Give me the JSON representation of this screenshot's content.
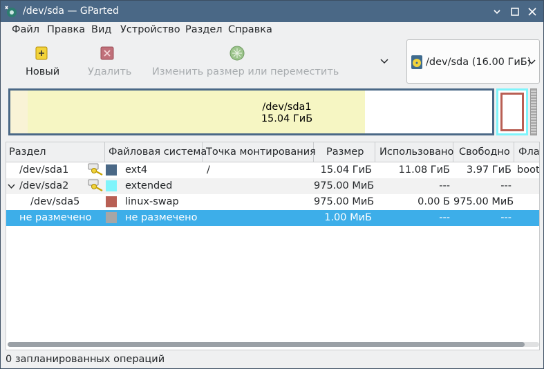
{
  "window": {
    "title": "/dev/sda — GParted",
    "accent_color": "#4a6886"
  },
  "menu": [
    "Файл",
    "Правка",
    "Вид",
    "Устройство",
    "Раздел",
    "Справка"
  ],
  "toolbar": {
    "new_label": "Новый",
    "delete_label": "Удалить",
    "resize_label": "Изменить размер или переместить",
    "device_label": "/dev/sda  (16.00 ГиБ)"
  },
  "partition_map": {
    "main_name": "/dev/sda1",
    "main_size": "15.04 ГиБ",
    "main_used_fraction": 0.736,
    "colors": {
      "ext4": "#4a6886",
      "extended": "#7ff4fb",
      "swap": "#b85f54",
      "unallocated": "#a6a6a6"
    }
  },
  "table": {
    "headers": [
      "Раздел",
      "Файловая система",
      "Точка монтирования",
      "Размер",
      "Использовано",
      "Свободно",
      "Флаги"
    ],
    "rows": [
      {
        "partition": "/dev/sda1",
        "fs": "ext4",
        "fs_color": "#4a6886",
        "mount": "/",
        "size": "15.04 ГиБ",
        "used": "11.08 ГиБ",
        "free": "3.97 ГиБ",
        "flags": "boot",
        "key": true
      },
      {
        "partition": "/dev/sda2",
        "fs": "extended",
        "fs_color": "#7ff4fb",
        "mount": "",
        "size": "975.00 МиБ",
        "used": "---",
        "free": "---",
        "flags": "",
        "key": true,
        "expanded": true
      },
      {
        "partition": "/dev/sda5",
        "fs": "linux-swap",
        "fs_color": "#b85f54",
        "mount": "",
        "size": "975.00 МиБ",
        "used": "0.00 Б",
        "free": "975.00 МиБ",
        "flags": "",
        "key": false
      },
      {
        "partition": "не размечено",
        "fs": "не размечено",
        "fs_color": "#a6a6a6",
        "mount": "",
        "size": "1.00 МиБ",
        "used": "---",
        "free": "---",
        "flags": "",
        "key": false,
        "selected": true
      }
    ]
  },
  "status": "0 запланированных операций"
}
